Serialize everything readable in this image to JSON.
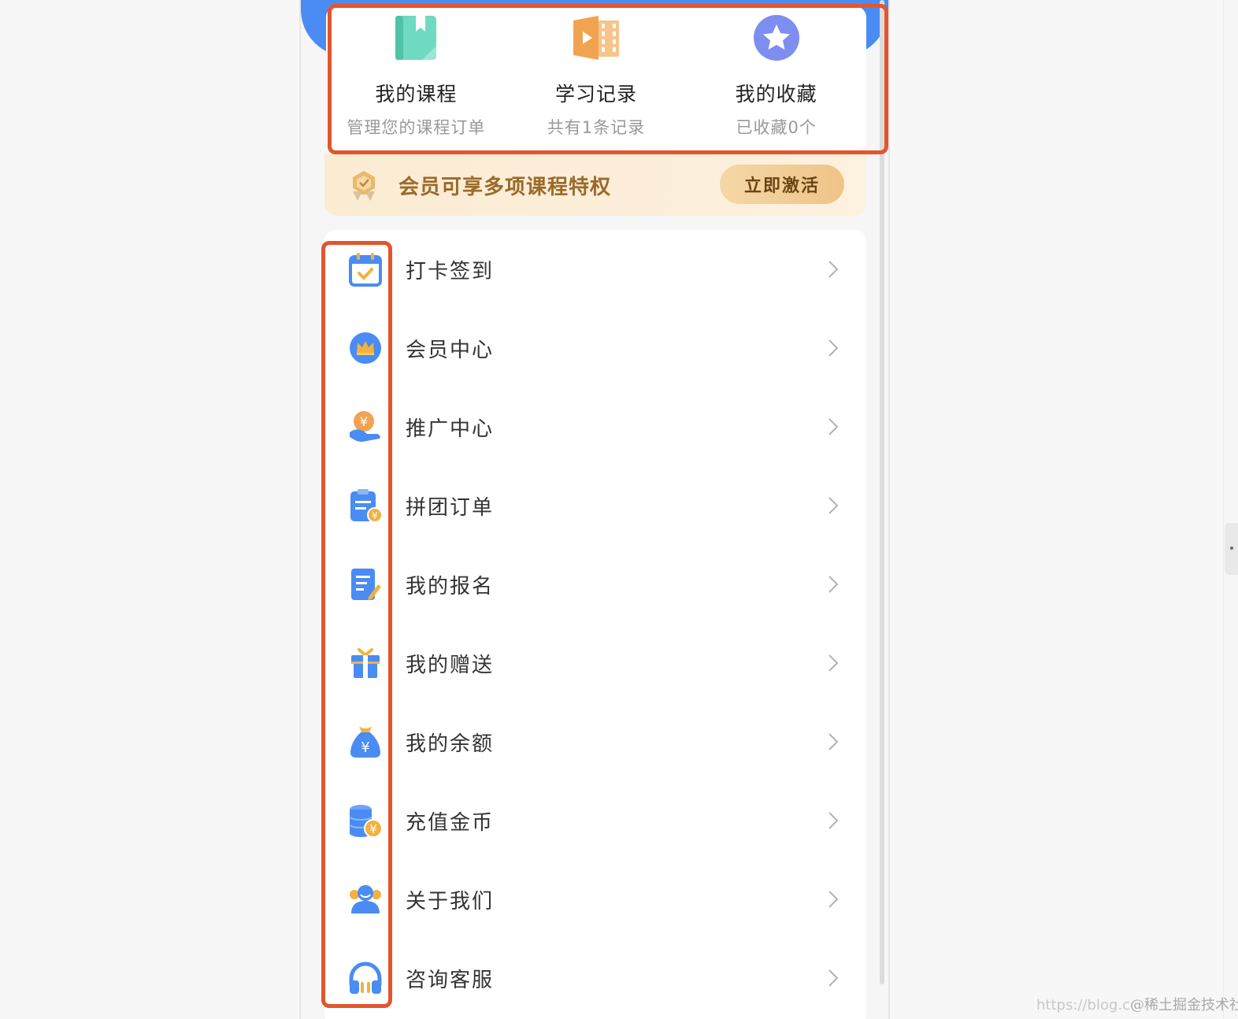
{
  "quick_links": [
    {
      "title": "我的课程",
      "subtitle": "管理您的课程订单",
      "icon": "book-icon",
      "color": "#6fd9c1"
    },
    {
      "title": "学习记录",
      "subtitle": "共有1条记录",
      "icon": "video-record-icon",
      "color": "#f2a350"
    },
    {
      "title": "我的收藏",
      "subtitle": "已收藏0个",
      "icon": "star-icon",
      "color": "#7d8ef0"
    }
  ],
  "vip_banner": {
    "text": "会员可享多项课程特权",
    "button_label": "立即激活",
    "icon": "vip-badge-icon"
  },
  "menu": [
    {
      "label": "打卡签到",
      "icon": "calendar-check-icon"
    },
    {
      "label": "会员中心",
      "icon": "crown-icon"
    },
    {
      "label": "推广中心",
      "icon": "hand-coin-icon"
    },
    {
      "label": "拼团订单",
      "icon": "clipboard-icon"
    },
    {
      "label": "我的报名",
      "icon": "edit-form-icon"
    },
    {
      "label": "我的赠送",
      "icon": "gift-icon"
    },
    {
      "label": "我的余额",
      "icon": "money-bag-icon"
    },
    {
      "label": "充值金币",
      "icon": "coins-icon"
    },
    {
      "label": "关于我们",
      "icon": "user-icon"
    },
    {
      "label": "咨询客服",
      "icon": "headset-icon"
    }
  ],
  "watermark": {
    "faded": "https://blog.c",
    "text": "@稀土掘金技术社区"
  },
  "colors": {
    "primary_blue": "#4a8cf3",
    "highlight_red": "#e4552d",
    "vip_gold": "#9a6a2a"
  }
}
